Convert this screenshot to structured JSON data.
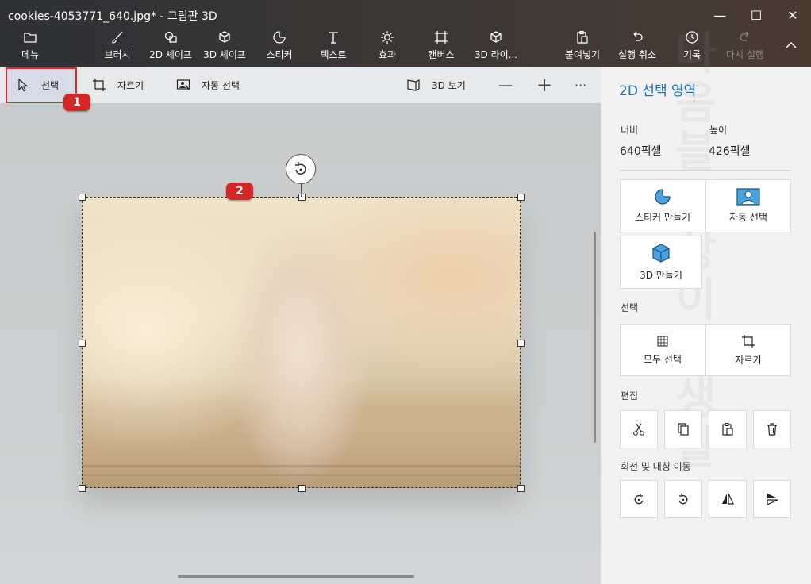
{
  "window": {
    "title": "cookies-4053771_640.jpg* - 그림판 3D",
    "minimize": "—",
    "maximize": "☐",
    "close": "✕"
  },
  "toolbar": {
    "menu": "메뉴",
    "brush": "브러시",
    "shapes2d": "2D 셰이프",
    "shapes3d": "3D 셰이프",
    "sticker": "스티커",
    "text": "텍스트",
    "effects": "효과",
    "canvas": "캔버스",
    "library3d": "3D 라이...",
    "paste": "붙여넣기",
    "undo": "실행 취소",
    "history": "기록",
    "redo": "다시 실행"
  },
  "subtoolbar": {
    "select": "선택",
    "crop": "자르기",
    "magic_select": "자동 선택",
    "view3d": "3D 보기",
    "zoom_out": "—",
    "zoom_in": "+",
    "more": "···"
  },
  "markers": [
    "1",
    "2"
  ],
  "panel": {
    "title": "2D 선택 영역",
    "width_label": "너비",
    "width_value": "640픽셀",
    "height_label": "높이",
    "height_value": "426픽셀",
    "make_sticker": "스티커 만들기",
    "magic_select": "자동 선택",
    "make_3d": "3D 만들기",
    "section_select": "선택",
    "select_all": "모두 선택",
    "crop": "자르기",
    "section_edit": "편집",
    "section_rotate": "회전 및 대칭 이동",
    "watermark": "다음블세상이웃생활"
  },
  "colors": {
    "accent": "#1a6fb3",
    "marker": "#d42626",
    "highlight": "#e02b2b"
  }
}
